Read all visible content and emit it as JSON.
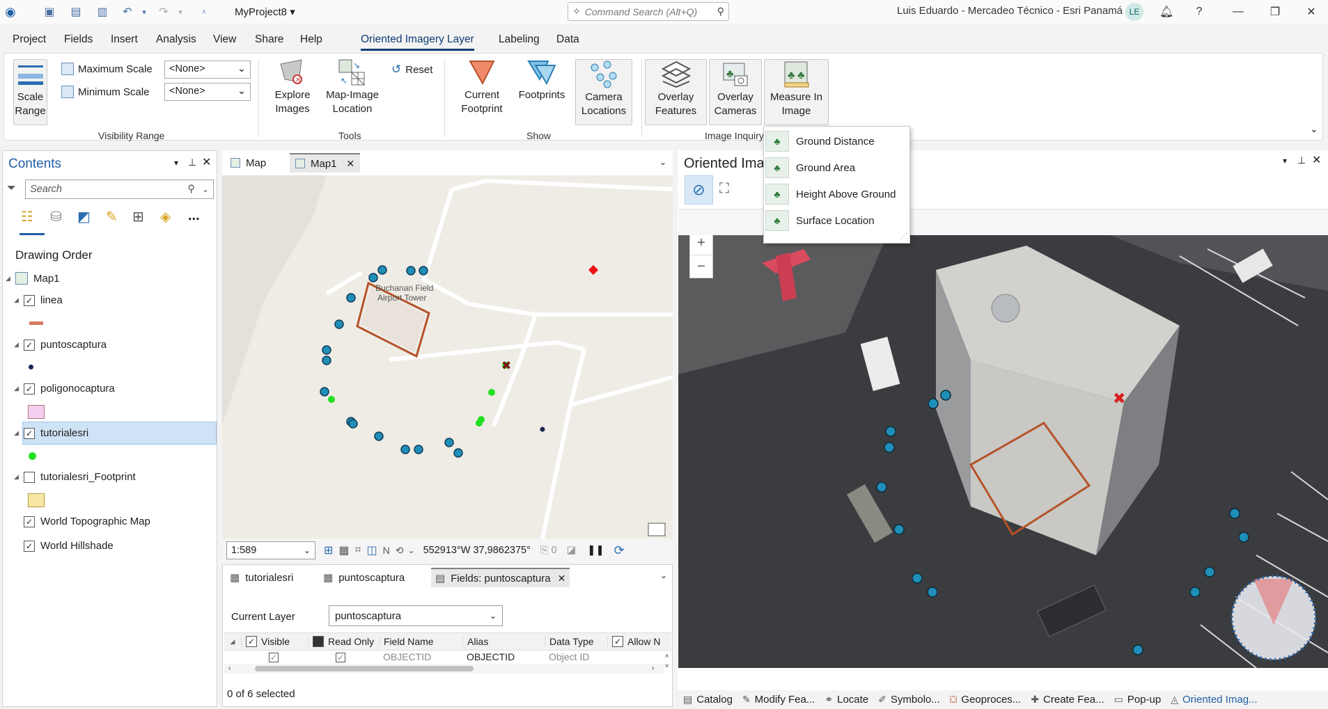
{
  "titlebar": {
    "project_name": "MyProject8 ▾",
    "command_search_placeholder": "Command Search (Alt+Q)",
    "user": "Luis Eduardo  - Mercadeo Técnico - Esri Panamá",
    "avatar_initials": "LE",
    "help": "?"
  },
  "menu": {
    "tabs": [
      "Project",
      "Fields",
      "Insert",
      "Analysis",
      "View",
      "Share",
      "Help",
      "Oriented Imagery Layer",
      "Labeling",
      "Data"
    ],
    "active_tab": "Oriented Imagery Layer"
  },
  "ribbon": {
    "scale_range": "Scale Range",
    "maximum_scale_label": "Maximum Scale",
    "maximum_scale_value": "<None>",
    "minimum_scale_label": "Minimum Scale",
    "minimum_scale_value": "<None>",
    "visibility_range": "Visibility Range",
    "explore_images": "Explore Images",
    "map_image_location": "Map-Image Location",
    "reset": "Reset",
    "tools": "Tools",
    "current_footprint": "Current Footprint",
    "footprints": "Footprints",
    "camera_locations": "Camera Locations",
    "show": "Show",
    "overlay_features": "Overlay Features",
    "overlay_cameras": "Overlay Cameras",
    "measure_in_image": "Measure In Image",
    "image_inquiry": "Image Inquiry"
  },
  "measure_menu": {
    "items": [
      "Ground Distance",
      "Ground Area",
      "Height Above Ground",
      "Surface Location"
    ]
  },
  "contents": {
    "title": "Contents",
    "search_placeholder": "Search",
    "drawing_order": "Drawing Order",
    "more": "...",
    "map_name": "Map1",
    "layers": [
      {
        "name": "linea",
        "checked": true
      },
      {
        "name": "puntoscaptura",
        "checked": true
      },
      {
        "name": "poligonocaptura",
        "checked": true
      },
      {
        "name": "tutorialesri",
        "checked": true,
        "selected": true
      },
      {
        "name": "tutorialesri_Footprint",
        "checked": false
      },
      {
        "name": "World Topographic Map",
        "checked": true
      },
      {
        "name": "World Hillshade",
        "checked": true
      }
    ]
  },
  "mapview": {
    "tabs": [
      "Map",
      "Map1"
    ],
    "active_tab": "Map1",
    "label_line1": "Buchanan Field",
    "label_line2": "Airport Tower",
    "scale": "1:589",
    "coordinates": "552913°W 37,9862375°",
    "selection_count": "0"
  },
  "tablepane": {
    "tabs": [
      "tutorialesri",
      "puntoscaptura",
      "Fields: puntoscaptura"
    ],
    "active_tab": "Fields: puntoscaptura",
    "current_layer_label": "Current Layer",
    "current_layer_value": "puntoscaptura",
    "columns": [
      "Visible",
      "Read Only",
      "Field Name",
      "Alias",
      "Data Type",
      "Allow N"
    ],
    "first_row": {
      "field_name": "OBJECTID",
      "alias": "OBJECTID",
      "data_type": "Object ID"
    },
    "selected_status": "0 of 6 selected"
  },
  "oipane": {
    "title": "Oriented Ima"
  },
  "docktabs": [
    "Catalog",
    "Modify Fea...",
    "Locate",
    "Symbolo...",
    "Geoproces...",
    "Create Fea...",
    "Pop-up",
    "Oriented Imag..."
  ],
  "colors": {
    "accent": "#0c3d73",
    "point_blue": "#1f8fb8",
    "point_green": "#22e022",
    "footprint": "#b5532a",
    "selected_row": "#cfe3f6"
  }
}
